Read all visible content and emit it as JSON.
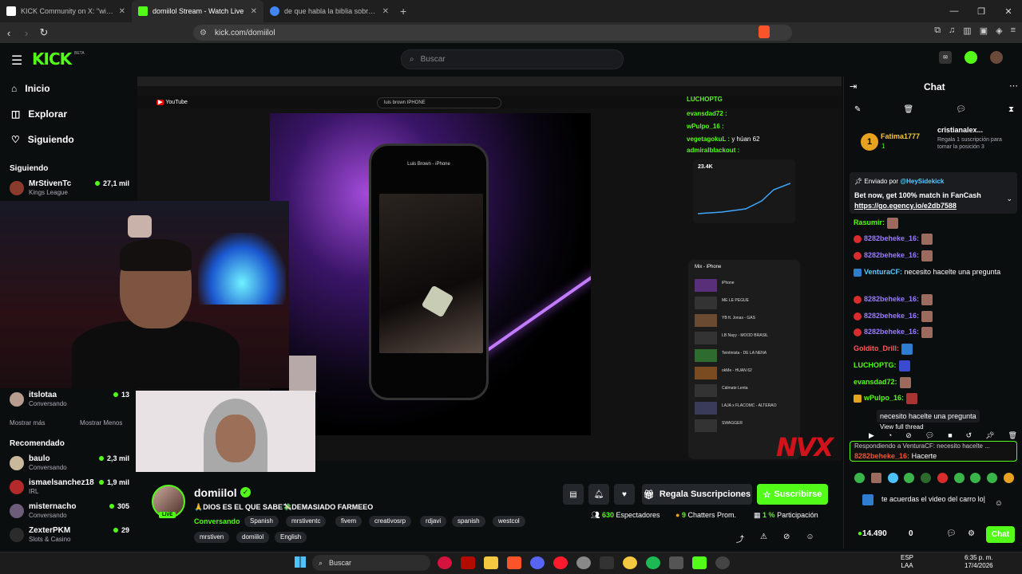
{
  "browser": {
    "tabs": [
      {
        "label": "KICK Community on X: \"win a game",
        "color": "#ffffff"
      },
      {
        "label": "domiilol Stream - Watch Live",
        "color": "#53fc18"
      },
      {
        "label": "de que habla la biblia sobre el amor",
        "color": "#4285f4"
      }
    ],
    "url": "kick.com/domiilol"
  },
  "header": {
    "logo": "KICK",
    "beta": "BETA",
    "search_placeholder": "Buscar"
  },
  "sidebar": {
    "nav": [
      {
        "label": "Inicio",
        "icon": "home-icon"
      },
      {
        "label": "Explorar",
        "icon": "compass-icon"
      },
      {
        "label": "Siguiendo",
        "icon": "heart-icon"
      }
    ],
    "following_title": "Siguiendo",
    "following": [
      {
        "name": "MrStivenTc",
        "category": "Kings League",
        "viewers": "27,1 mil"
      },
      {
        "name": "itslotaa",
        "category": "Conversando",
        "viewers": "13"
      }
    ],
    "show_more": "Mostrar más",
    "show_less": "Mostrar Menos",
    "recommended_title": "Recomendado",
    "recommended": [
      {
        "name": "baulo",
        "category": "Conversando",
        "viewers": "2,3 mil"
      },
      {
        "name": "ismaelsanchez18",
        "category": "IRL",
        "viewers": "1,9 mil"
      },
      {
        "name": "misternacho",
        "category": "Conversando",
        "viewers": "305"
      },
      {
        "name": "ZexterPKM",
        "category": "Slots & Casino",
        "viewers": "29"
      }
    ]
  },
  "video": {
    "yt_search": "luis brown IPHONE",
    "phone_title": "Luis Brown - iPhone",
    "stats_value": "23.4K",
    "mix_title": "Mix - iPhone",
    "mix_items": [
      "iPhone",
      "ME LE PEGUE",
      "YB ft. Jonas - GAS",
      "LB Nayy - MOOD BRASIL",
      "Teintinista - DE LA NENA",
      "okMe - HUAN 62",
      "Cálmate Lenta",
      "LAJA x FLACOMC - ALTERAO",
      "SWAGGER"
    ],
    "overlay_chat": [
      {
        "user": "LUCHOPTG",
        "msg": ""
      },
      {
        "user": "evansdad72 :",
        "msg": ""
      },
      {
        "user": "wPulpo_16 :",
        "msg": ""
      },
      {
        "user": "vegetagokuL :",
        "msg": "y húan 62"
      },
      {
        "user": "admiralblackout :",
        "msg": ""
      }
    ],
    "watermark": "NVX"
  },
  "channel": {
    "name": "domiilol",
    "live": "LIVE",
    "title": "🙏DIOS ES EL QUE SABE💸DEMASIADO FARMEEO",
    "category": "Conversando",
    "tags": [
      "Spanish",
      "mrstiventc",
      "fivem",
      "creativosrp",
      "rdjavi",
      "spanish",
      "westcol",
      "mrstiven",
      "domiilol",
      "English"
    ],
    "gift_label": "Regala Suscripciones",
    "subscribe_label": "Suscribirse",
    "viewers": "630",
    "viewers_label": "Espectadores",
    "chatters": "9",
    "chatters_label": "Chatters Prom.",
    "participation": "1 %",
    "participation_label": "Participación"
  },
  "chat": {
    "title": "Chat",
    "leader": {
      "rank": "1",
      "name": "Fatima1777",
      "count": "1"
    },
    "gifter": {
      "name": "cristianalex...",
      "count": "1",
      "note": "Regala 1 suscripción para tomar la posición 3"
    },
    "pinned": {
      "sent_by": "Enviado por",
      "sender": "@HeySidekick",
      "message": "Bet now, get 100% match in FanCash",
      "link": "https://go.egency.io/e2db7588"
    },
    "messages": [
      {
        "user": "Rasumir:",
        "text": "",
        "color": "#53fc18"
      },
      {
        "user": "8282beheke_16:",
        "text": "",
        "color": "#9b7cff"
      },
      {
        "user": "8282beheke_16:",
        "text": "",
        "color": "#9b7cff"
      },
      {
        "user": "VenturaCF:",
        "text": "necesito hacelte una pregunta",
        "color": "#5ecbff"
      },
      {
        "user": "8282beheke_16:",
        "text": "",
        "color": "#9b7cff"
      },
      {
        "user": "8282beheke_16:",
        "text": "",
        "color": "#9b7cff"
      },
      {
        "user": "8282beheke_16:",
        "text": "",
        "color": "#9b7cff"
      },
      {
        "user": "Goldito_Drill:",
        "text": "",
        "color": "#ff5b5b"
      },
      {
        "user": "LUCHOPTG:",
        "text": "",
        "color": "#53fc18"
      },
      {
        "user": "evansdad72:",
        "text": "",
        "color": "#53fc18"
      },
      {
        "user": "wPulpo_16:",
        "text": "",
        "color": "#53fc18"
      }
    ],
    "thread_preview": "necesito hacelte una pregunta",
    "view_thread": "View full thread",
    "reply_to": "Respondiendo a VenturaCF: necesito hacelte ...",
    "reply_user": "8282beheke_16:",
    "reply_text": "Hacerte",
    "input_text": "te acuerdas el video del carro lo|",
    "points": "14.490",
    "zero": "0",
    "send_label": "Chat"
  },
  "taskbar": {
    "search": "Buscar",
    "lang": "ESP",
    "lang2": "LAA",
    "time": "6:35 p. m.",
    "date": "17/4/2026"
  }
}
